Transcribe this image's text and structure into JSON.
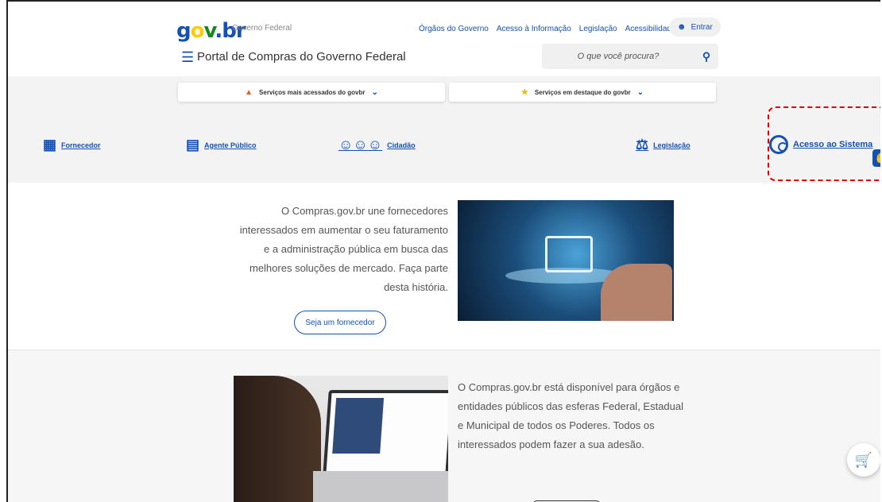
{
  "header": {
    "logo_g": "go",
    "logo_v": "v",
    "logo_b": ".br",
    "gov_federal": "Governo Federal",
    "links": [
      "Órgãos do Governo",
      "Acesso à Informação",
      "Legislação",
      "Acessibilidade"
    ],
    "entrar": "Entrar",
    "portal_title": "Portal de Compras do Governo Federal",
    "search_placeholder": "O que você procura?"
  },
  "services": {
    "most_accessed": "Serviços mais acessados do govbr",
    "featured": "Serviços em destaque do govbr"
  },
  "categories": [
    "Fornecedor",
    "Agente Público",
    "Cidadão",
    "Legislação",
    "Acesso ao Sistema"
  ],
  "section1": {
    "text": "O Compras.gov.br une fornecedores interessados em aumentar o seu faturamento e a administração pública em busca das melhores soluções de mercado. Faça parte desta história.",
    "cta": "Seja um fornecedor"
  },
  "section2": {
    "text": "O Compras.gov.br está disponível para órgãos e entidades públicos das esferas Federal, Estadual e Municipal de todos os Poderes. Todos os interessados podem fazer a sua adesão."
  },
  "colors": {
    "accent": "#1351b4",
    "highlight": "#e00000"
  }
}
